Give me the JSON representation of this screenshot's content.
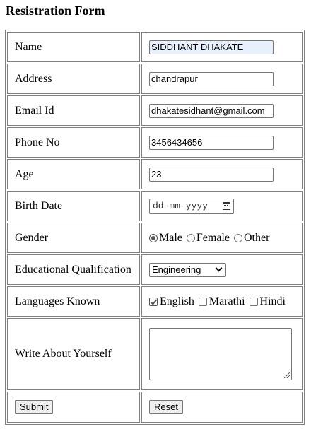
{
  "page": {
    "title": "Resistration Form"
  },
  "form": {
    "name": {
      "label": "Name",
      "value": "SIDDHANT DHAKATE"
    },
    "address": {
      "label": "Address",
      "value": "chandrapur"
    },
    "email": {
      "label": "Email Id",
      "value": "dhakatesidhant@gmail.com"
    },
    "phone": {
      "label": "Phone No",
      "value": "3456434656"
    },
    "age": {
      "label": "Age",
      "value": "23"
    },
    "birth_date": {
      "label": "Birth Date",
      "placeholder": "dd-mm-yyyy",
      "icon": "calendar-icon"
    },
    "gender": {
      "label": "Gender",
      "options": [
        {
          "label": "Male",
          "checked": true
        },
        {
          "label": "Female",
          "checked": false
        },
        {
          "label": "Other",
          "checked": false
        }
      ]
    },
    "qualification": {
      "label": "Educational Qualification",
      "selected": "Engineering"
    },
    "languages": {
      "label": "Languages Known",
      "options": [
        {
          "label": "English",
          "checked": true
        },
        {
          "label": "Marathi",
          "checked": false
        },
        {
          "label": "Hindi",
          "checked": false
        }
      ]
    },
    "about": {
      "label": "Write About Yourself",
      "value": ""
    },
    "submit_label": "Submit",
    "reset_label": "Reset"
  },
  "colors": {
    "autofill_background": "#e8f0fe",
    "border": "#808080",
    "button_background": "#efefef"
  }
}
